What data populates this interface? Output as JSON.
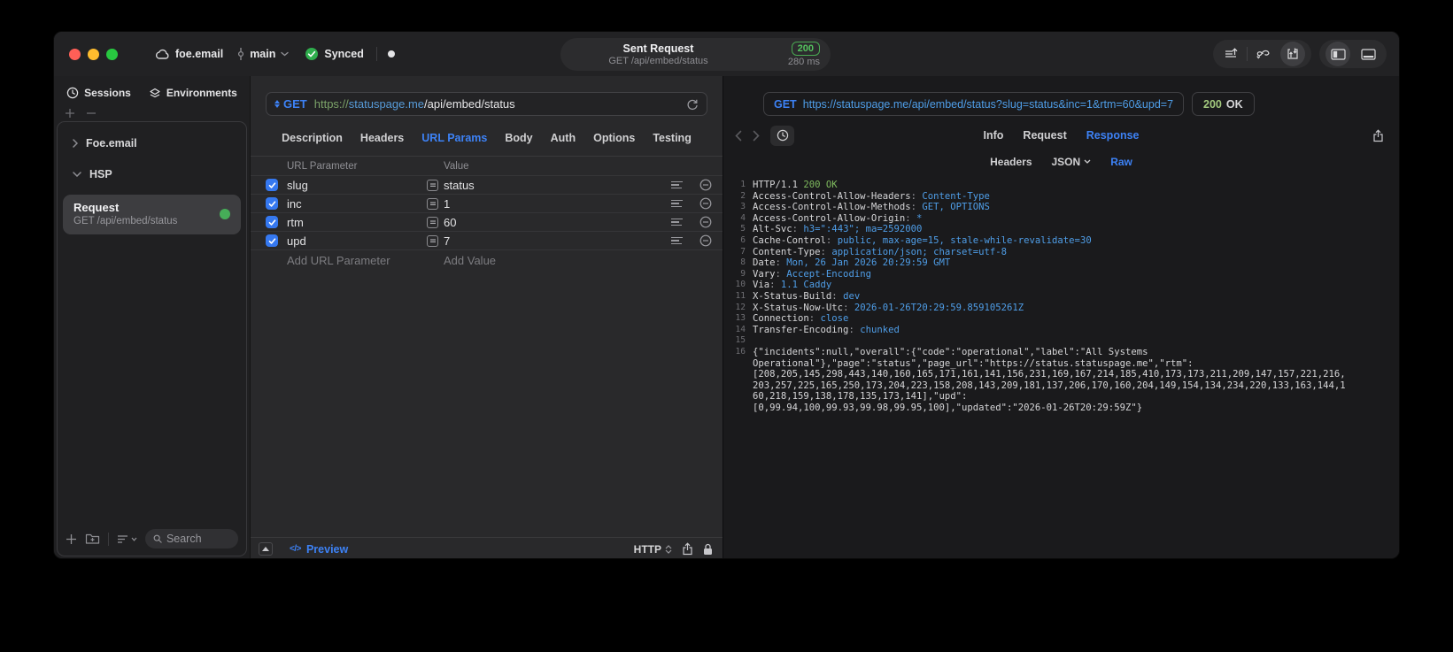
{
  "titlebar": {
    "project": "foe.email",
    "branch": "main",
    "sync_label": "Synced",
    "request_title": "Sent Request",
    "request_subtitle": "GET /api/embed/status",
    "status_code": "200",
    "duration": "280 ms"
  },
  "sidebar": {
    "tabs": [
      {
        "label": "Sessions"
      },
      {
        "label": "Environments"
      }
    ],
    "tree": [
      {
        "label": "Foe.email"
      },
      {
        "label": "HSP"
      }
    ],
    "request_item": {
      "title": "Request",
      "subtitle": "GET /api/embed/status"
    },
    "search_placeholder": "Search"
  },
  "request_pane": {
    "method": "GET",
    "url": {
      "scheme": "https://",
      "host": "statuspage.me",
      "path": "/api/embed/status"
    },
    "tabs": [
      "Description",
      "Headers",
      "URL Params",
      "Body",
      "Auth",
      "Options",
      "Testing"
    ],
    "active_tab": "URL Params",
    "param_table": {
      "columns": [
        "URL Parameter",
        "Value"
      ],
      "rows": [
        {
          "enabled": true,
          "name": "slug",
          "value": "status"
        },
        {
          "enabled": true,
          "name": "inc",
          "value": "1"
        },
        {
          "enabled": true,
          "name": "rtm",
          "value": "60"
        },
        {
          "enabled": true,
          "name": "upd",
          "value": "7"
        }
      ],
      "add_parameter_placeholder": "Add URL Parameter",
      "add_value_placeholder": "Add Value"
    },
    "footer": {
      "preview_glyph": "</>",
      "preview_label": "Preview",
      "protocol": "HTTP"
    }
  },
  "response_pane": {
    "method": "GET",
    "url": "https://statuspage.me/api/embed/status?slug=status&inc=1&rtm=60&upd=7",
    "status_code": "200",
    "status_text": "OK",
    "tabs": [
      "Info",
      "Request",
      "Response"
    ],
    "active_tab": "Response",
    "subtabs": [
      "Headers",
      "JSON",
      "Raw"
    ],
    "active_subtab": "Raw",
    "body_lines": [
      {
        "n": "1",
        "segs": [
          [
            "plain",
            "HTTP/1.1 "
          ],
          [
            "green",
            "200 OK"
          ]
        ]
      },
      {
        "n": "2",
        "segs": [
          [
            "plain",
            "Access-Control-Allow-Headers"
          ],
          [
            "dim",
            ": "
          ],
          [
            "blue",
            "Content-Type"
          ]
        ]
      },
      {
        "n": "3",
        "segs": [
          [
            "plain",
            "Access-Control-Allow-Methods"
          ],
          [
            "dim",
            ": "
          ],
          [
            "blue",
            "GET, OPTIONS"
          ]
        ]
      },
      {
        "n": "4",
        "segs": [
          [
            "plain",
            "Access-Control-Allow-Origin"
          ],
          [
            "dim",
            ": "
          ],
          [
            "blue",
            "*"
          ]
        ]
      },
      {
        "n": "5",
        "segs": [
          [
            "plain",
            "Alt-Svc"
          ],
          [
            "dim",
            ": "
          ],
          [
            "blue",
            "h3=\":443\"; ma=2592000"
          ]
        ]
      },
      {
        "n": "6",
        "segs": [
          [
            "plain",
            "Cache-Control"
          ],
          [
            "dim",
            ": "
          ],
          [
            "blue",
            "public, max-age=15, stale-while-revalidate=30"
          ]
        ]
      },
      {
        "n": "7",
        "segs": [
          [
            "plain",
            "Content-Type"
          ],
          [
            "dim",
            ": "
          ],
          [
            "blue",
            "application/json; charset=utf-8"
          ]
        ]
      },
      {
        "n": "8",
        "segs": [
          [
            "plain",
            "Date"
          ],
          [
            "dim",
            ": "
          ],
          [
            "blue",
            "Mon, 26 Jan 2026 20:29:59 GMT"
          ]
        ]
      },
      {
        "n": "9",
        "segs": [
          [
            "plain",
            "Vary"
          ],
          [
            "dim",
            ": "
          ],
          [
            "blue",
            "Accept-Encoding"
          ]
        ]
      },
      {
        "n": "10",
        "segs": [
          [
            "plain",
            "Via"
          ],
          [
            "dim",
            ": "
          ],
          [
            "blue",
            "1.1 Caddy"
          ]
        ]
      },
      {
        "n": "11",
        "segs": [
          [
            "plain",
            "X-Status-Build"
          ],
          [
            "dim",
            ": "
          ],
          [
            "blue",
            "dev"
          ]
        ]
      },
      {
        "n": "12",
        "segs": [
          [
            "plain",
            "X-Status-Now-Utc"
          ],
          [
            "dim",
            ": "
          ],
          [
            "blue",
            "2026-01-26T20:29:59.859105261Z"
          ]
        ]
      },
      {
        "n": "13",
        "segs": [
          [
            "plain",
            "Connection"
          ],
          [
            "dim",
            ": "
          ],
          [
            "blue",
            "close"
          ]
        ]
      },
      {
        "n": "14",
        "segs": [
          [
            "plain",
            "Transfer-Encoding"
          ],
          [
            "dim",
            ": "
          ],
          [
            "blue",
            "chunked"
          ]
        ]
      },
      {
        "n": "15",
        "segs": []
      },
      {
        "n": "16",
        "segs": [
          [
            "plain",
            "{\"incidents\":null,\"overall\":{\"code\":\"operational\",\"label\":\"All Systems\nOperational\"},\"page\":\"status\",\"page_url\":\"https://status.statuspage.me\",\"rtm\":\n[208,205,145,298,443,140,160,165,171,161,141,156,231,169,167,214,185,410,173,173,211,209,147,157,221,216,\n203,257,225,165,250,173,204,223,158,208,143,209,181,137,206,170,160,204,149,154,134,234,220,133,163,144,1\n60,218,159,138,178,135,173,141],\"upd\":\n[0,99.94,100,99.93,99.98,99.95,100],\"updated\":\"2026-01-26T20:29:59Z\"}"
          ]
        ]
      }
    ]
  }
}
